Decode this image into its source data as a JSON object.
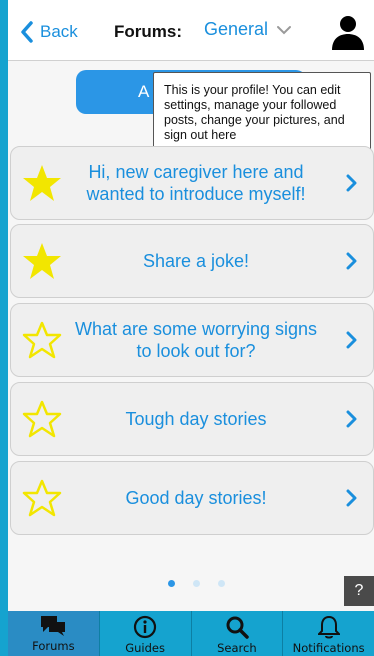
{
  "header": {
    "back_label": "Back",
    "title": "Forums:",
    "forum_selected": "General"
  },
  "add_button_label": "A",
  "tooltip": {
    "text": "This is your profile! You can edit settings, manage your followed posts, change your pictures, and sign out here"
  },
  "topics": [
    {
      "label": "Hi, new caregiver here and wanted to introduce myself!",
      "starred": true
    },
    {
      "label": "Share a joke!",
      "starred": true
    },
    {
      "label": "What are some worrying signs to look out for?",
      "starred": false
    },
    {
      "label": "Tough day stories",
      "starred": false
    },
    {
      "label": "Good day stories!",
      "starred": false
    }
  ],
  "pager": {
    "count": 3,
    "active": 1
  },
  "help_label": "?",
  "tabs": [
    {
      "label": "Forums",
      "icon": "chat-icon"
    },
    {
      "label": "Guides",
      "icon": "info-icon"
    },
    {
      "label": "Search",
      "icon": "search-icon"
    },
    {
      "label": "Notifications",
      "icon": "bell-icon"
    }
  ],
  "colors": {
    "accent": "#1a8fdd",
    "star_fill": "#f2e600",
    "tabbar": "#15a3cf",
    "tab_active": "#2a8cc4"
  }
}
